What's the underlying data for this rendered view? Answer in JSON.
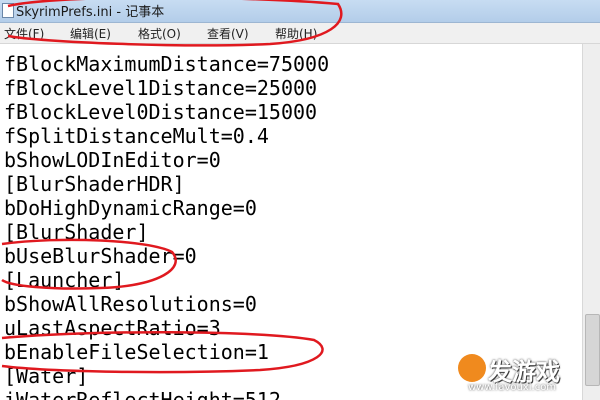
{
  "window": {
    "title": "SkyrimPrefs.ini - 记事本"
  },
  "menu": {
    "items": [
      "文件(F)",
      "编辑(E)",
      "格式(O)",
      "查看(V)",
      "帮助(H)"
    ]
  },
  "editor": {
    "lines": [
      "fBlockMaximumDistance=75000",
      "fBlockLevel1Distance=25000",
      "fBlockLevel0Distance=15000",
      "fSplitDistanceMult=0.4",
      "bShowLODInEditor=0",
      "[BlurShaderHDR]",
      "bDoHighDynamicRange=0",
      "[BlurShader]",
      "bUseBlurShader=0",
      "[Launcher]",
      "bShowAllResolutions=0",
      "uLastAspectRatio=3",
      "bEnableFileSelection=1",
      "[Water]",
      "iWaterReflectHeight=512"
    ]
  },
  "watermark": {
    "main": "发游戏",
    "sub": "www.favouxi.com"
  },
  "colors": {
    "annotation": "#e0191f",
    "titlebar": "#c7dcf2",
    "menubar": "#f0f0f0"
  }
}
